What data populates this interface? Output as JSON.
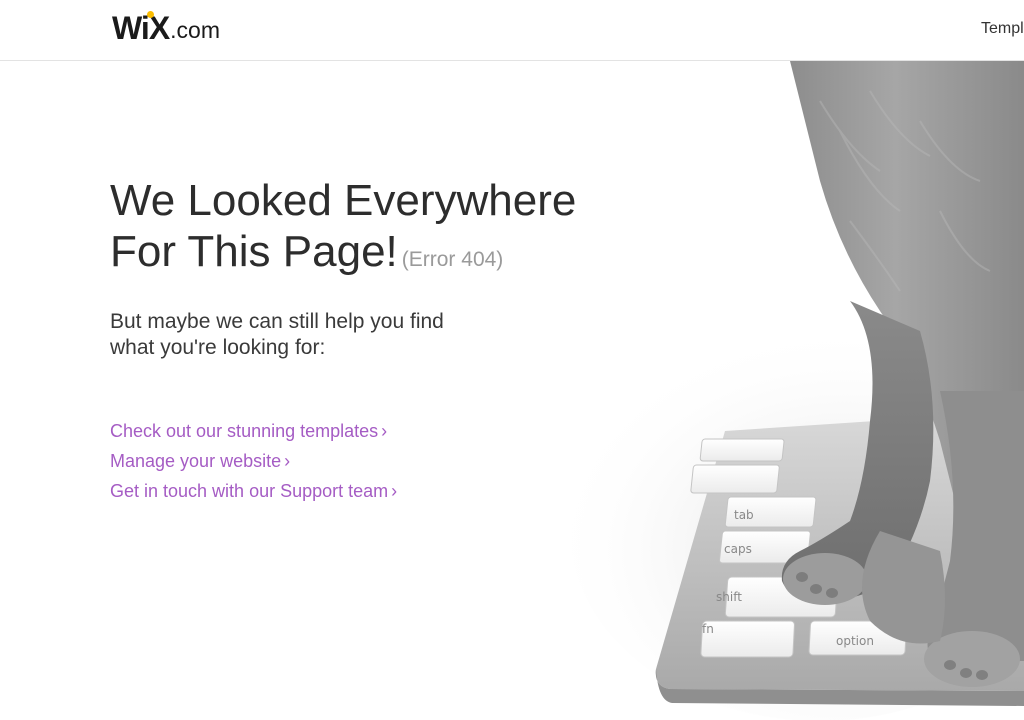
{
  "header": {
    "logo_wix": "WiX",
    "logo_com": ".com",
    "nav_templates": "Templ"
  },
  "main": {
    "headline_line1": "We Looked Everywhere",
    "headline_line2": "For This Page!",
    "error_code": "(Error 404)",
    "subhead_line1": "But maybe we can still help you find",
    "subhead_line2": "what you're looking for:",
    "links": [
      {
        "label": "Check out our stunning templates",
        "chevron": "›"
      },
      {
        "label": "Manage your website",
        "chevron": "›"
      },
      {
        "label": "Get in touch with our Support team",
        "chevron": "›"
      }
    ]
  },
  "keyboard_keys": {
    "tab": "tab",
    "caps": "caps",
    "shift": "shift",
    "fn": "fn",
    "option": "option"
  },
  "colors": {
    "link": "#a55cc4",
    "logo_dot": "#fbbd00",
    "headline": "#2d2d2d",
    "error_code": "#9a9a9a"
  },
  "icons": {
    "chevron": "chevron-right-icon",
    "illustration": "cat-on-keyboard-image"
  }
}
